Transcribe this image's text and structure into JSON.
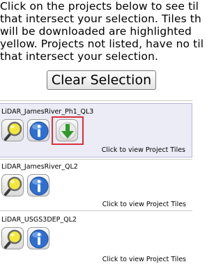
{
  "instructions": {
    "lines": [
      "Click on the projects below to see til",
      "that intersect your selection. Tiles th",
      "will be downloaded are highlighted",
      "yellow. Projects not listed, have no til",
      "that intersect your selection."
    ]
  },
  "clear_button": {
    "label": "Clear Selection"
  },
  "projects": [
    {
      "name": "LiDAR_JamesRiver_Ph1_QL3",
      "tiles_link": "Click to view Project Tiles",
      "has_download": true,
      "selected": true
    },
    {
      "name": "LiDAR_JamesRiver_QL2",
      "tiles_link": "Click to view Project Tiles",
      "has_download": false,
      "selected": false
    },
    {
      "name": "LiDAR_USGS3DEP_QL2",
      "tiles_link": "Click to view Project Tiles",
      "has_download": false,
      "selected": false
    }
  ],
  "colors": {
    "selected_background": "#ececf7",
    "highlight_border": "#d9303a",
    "info_blue": "#2f6fd0",
    "download_green": "#2f9a2a",
    "magnifier_yellow": "#f3e83a"
  },
  "icons": [
    "magnifier-icon",
    "info-icon",
    "download-arrow-icon"
  ]
}
